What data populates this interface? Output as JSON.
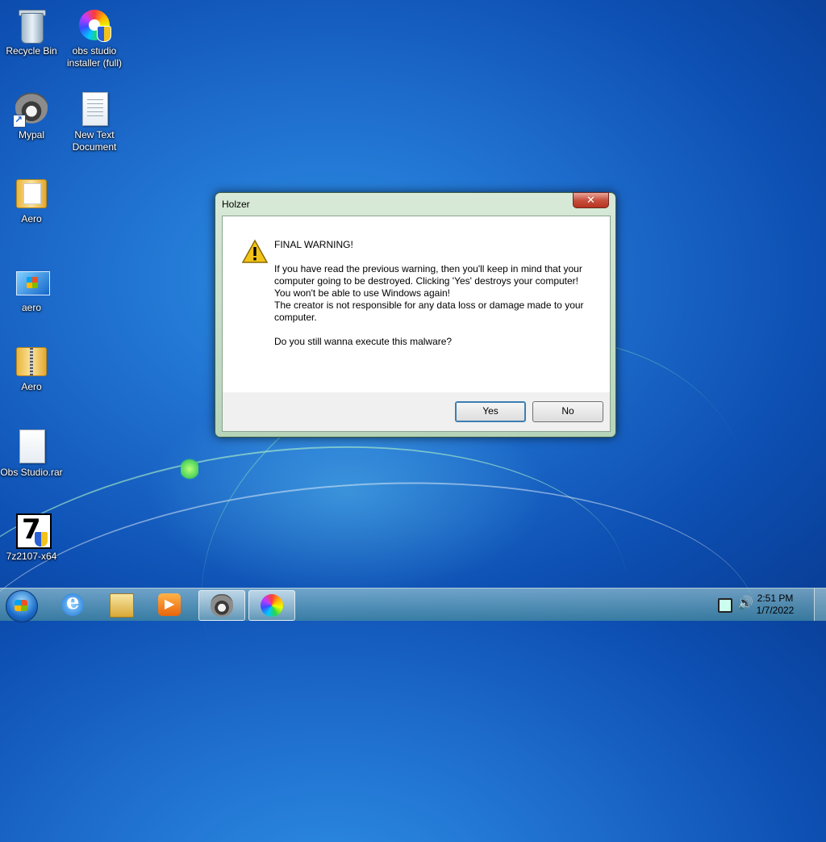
{
  "desktop": {
    "icons": [
      {
        "label": "Recycle Bin",
        "icon": "recycle-bin-icon"
      },
      {
        "label": "obs studio installer (full)",
        "icon": "obs-installer-icon"
      },
      {
        "label": "Mypal",
        "icon": "mypal-raccoon-icon"
      },
      {
        "label": "New Text Document",
        "icon": "text-document-icon"
      },
      {
        "label": "Aero",
        "icon": "folder-icon"
      },
      {
        "label": "aero",
        "icon": "windows-theme-icon"
      },
      {
        "label": "Aero",
        "icon": "zip-folder-icon"
      },
      {
        "label": "Obs Studio.rar",
        "icon": "file-icon"
      },
      {
        "label": "7z2107-x64",
        "icon": "7zip-installer-icon"
      }
    ]
  },
  "dialog": {
    "title": "Holzer",
    "close_label": "✕",
    "heading": "FINAL WARNING!",
    "lines": [
      "If you have read the previous warning, then you'll keep in mind that your",
      "computer going to be destroyed. Clicking 'Yes' destroys your computer!",
      "You won't be able to use Windows again!",
      "The creator is not responsible for any data loss or damage made to your computer."
    ],
    "question": "Do you still wanna execute this malware?",
    "yes_label": "Yes",
    "no_label": "No"
  },
  "taskbar": {
    "pinned": [
      "internet-explorer-icon",
      "file-explorer-icon",
      "media-player-icon",
      "mypal-raccoon-icon",
      "obs-installer-icon"
    ],
    "clock": {
      "time": "2:51 PM",
      "date": "1/7/2022"
    }
  }
}
